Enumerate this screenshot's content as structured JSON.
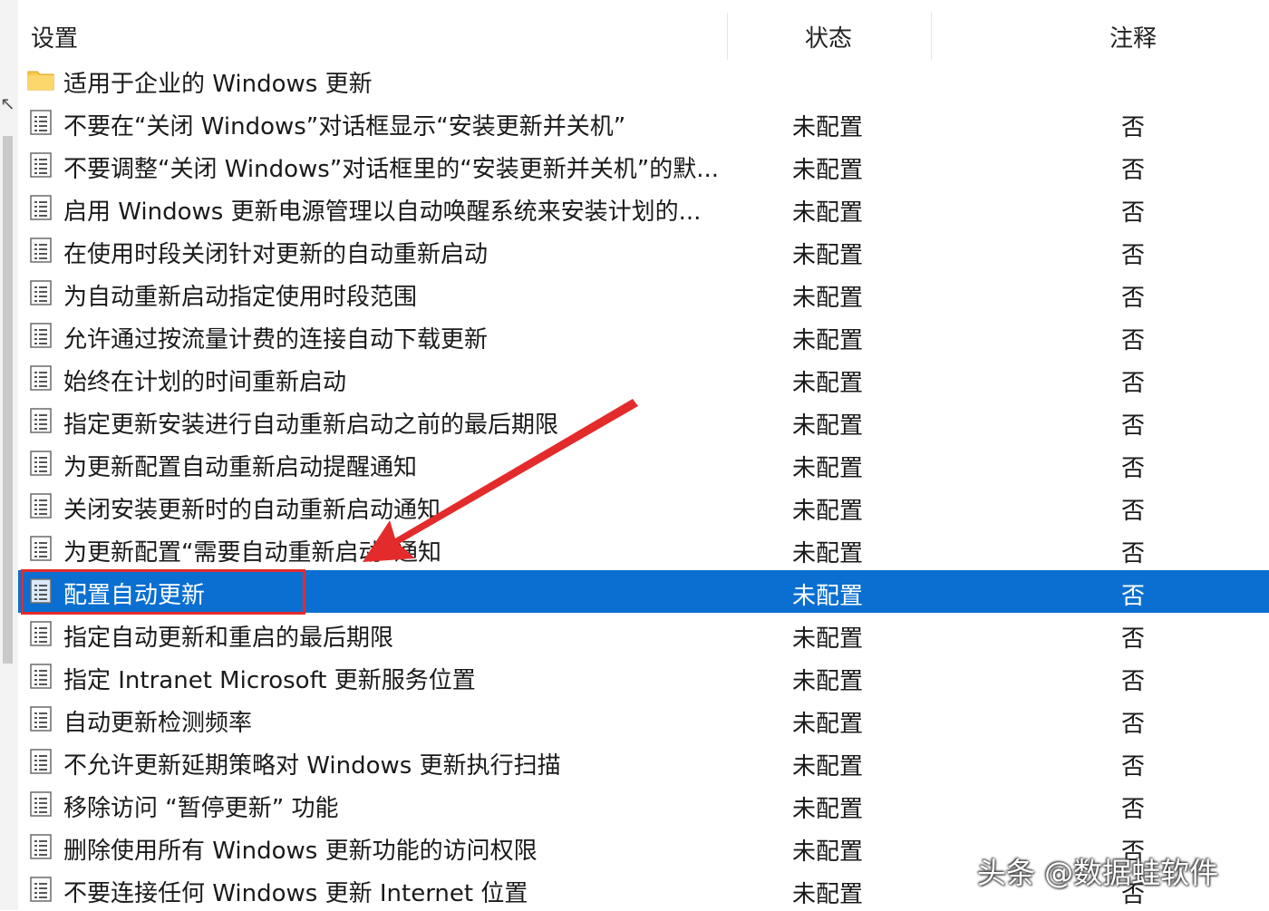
{
  "header": {
    "col_setting": "设置",
    "col_status": "状态",
    "col_note": "注释"
  },
  "folder": {
    "label": "适用于企业的 Windows 更新",
    "icon": "folder-icon"
  },
  "rows": [
    {
      "name": "不要在“关闭 Windows”对话框显示“安装更新并关机”",
      "status": "未配置",
      "note": "否"
    },
    {
      "name": "不要调整“关闭 Windows”对话框里的“安装更新并关机”的默...",
      "status": "未配置",
      "note": "否"
    },
    {
      "name": "启用 Windows 更新电源管理以自动唤醒系统来安装计划的...",
      "status": "未配置",
      "note": "否"
    },
    {
      "name": "在使用时段关闭针对更新的自动重新启动",
      "status": "未配置",
      "note": "否"
    },
    {
      "name": "为自动重新启动指定使用时段范围",
      "status": "未配置",
      "note": "否"
    },
    {
      "name": "允许通过按流量计费的连接自动下载更新",
      "status": "未配置",
      "note": "否"
    },
    {
      "name": "始终在计划的时间重新启动",
      "status": "未配置",
      "note": "否"
    },
    {
      "name": "指定更新安装进行自动重新启动之前的最后期限",
      "status": "未配置",
      "note": "否"
    },
    {
      "name": "为更新配置自动重新启动提醒通知",
      "status": "未配置",
      "note": "否"
    },
    {
      "name": "关闭安装更新时的自动重新启动通知",
      "status": "未配置",
      "note": "否"
    },
    {
      "name": "为更新配置“需要自动重新启动”通知",
      "status": "未配置",
      "note": "否"
    },
    {
      "name": "配置自动更新",
      "status": "未配置",
      "note": "否",
      "selected": true
    },
    {
      "name": "指定自动更新和重启的最后期限",
      "status": "未配置",
      "note": "否"
    },
    {
      "name": "指定 Intranet Microsoft 更新服务位置",
      "status": "未配置",
      "note": "否"
    },
    {
      "name": "自动更新检测频率",
      "status": "未配置",
      "note": "否"
    },
    {
      "name": "不允许更新延期策略对 Windows 更新执行扫描",
      "status": "未配置",
      "note": "否"
    },
    {
      "name": "移除访问 “暂停更新” 功能",
      "status": "未配置",
      "note": "否"
    },
    {
      "name": "删除使用所有 Windows 更新功能的访问权限",
      "status": "未配置",
      "note": "否"
    },
    {
      "name": "不要连接任何 Windows 更新 Internet 位置",
      "status": "未配置",
      "note": "否"
    }
  ],
  "watermark": "头条 @数据蛙软件",
  "colors": {
    "selection": "#0a6fd1",
    "annotation": "#e32b2b"
  }
}
